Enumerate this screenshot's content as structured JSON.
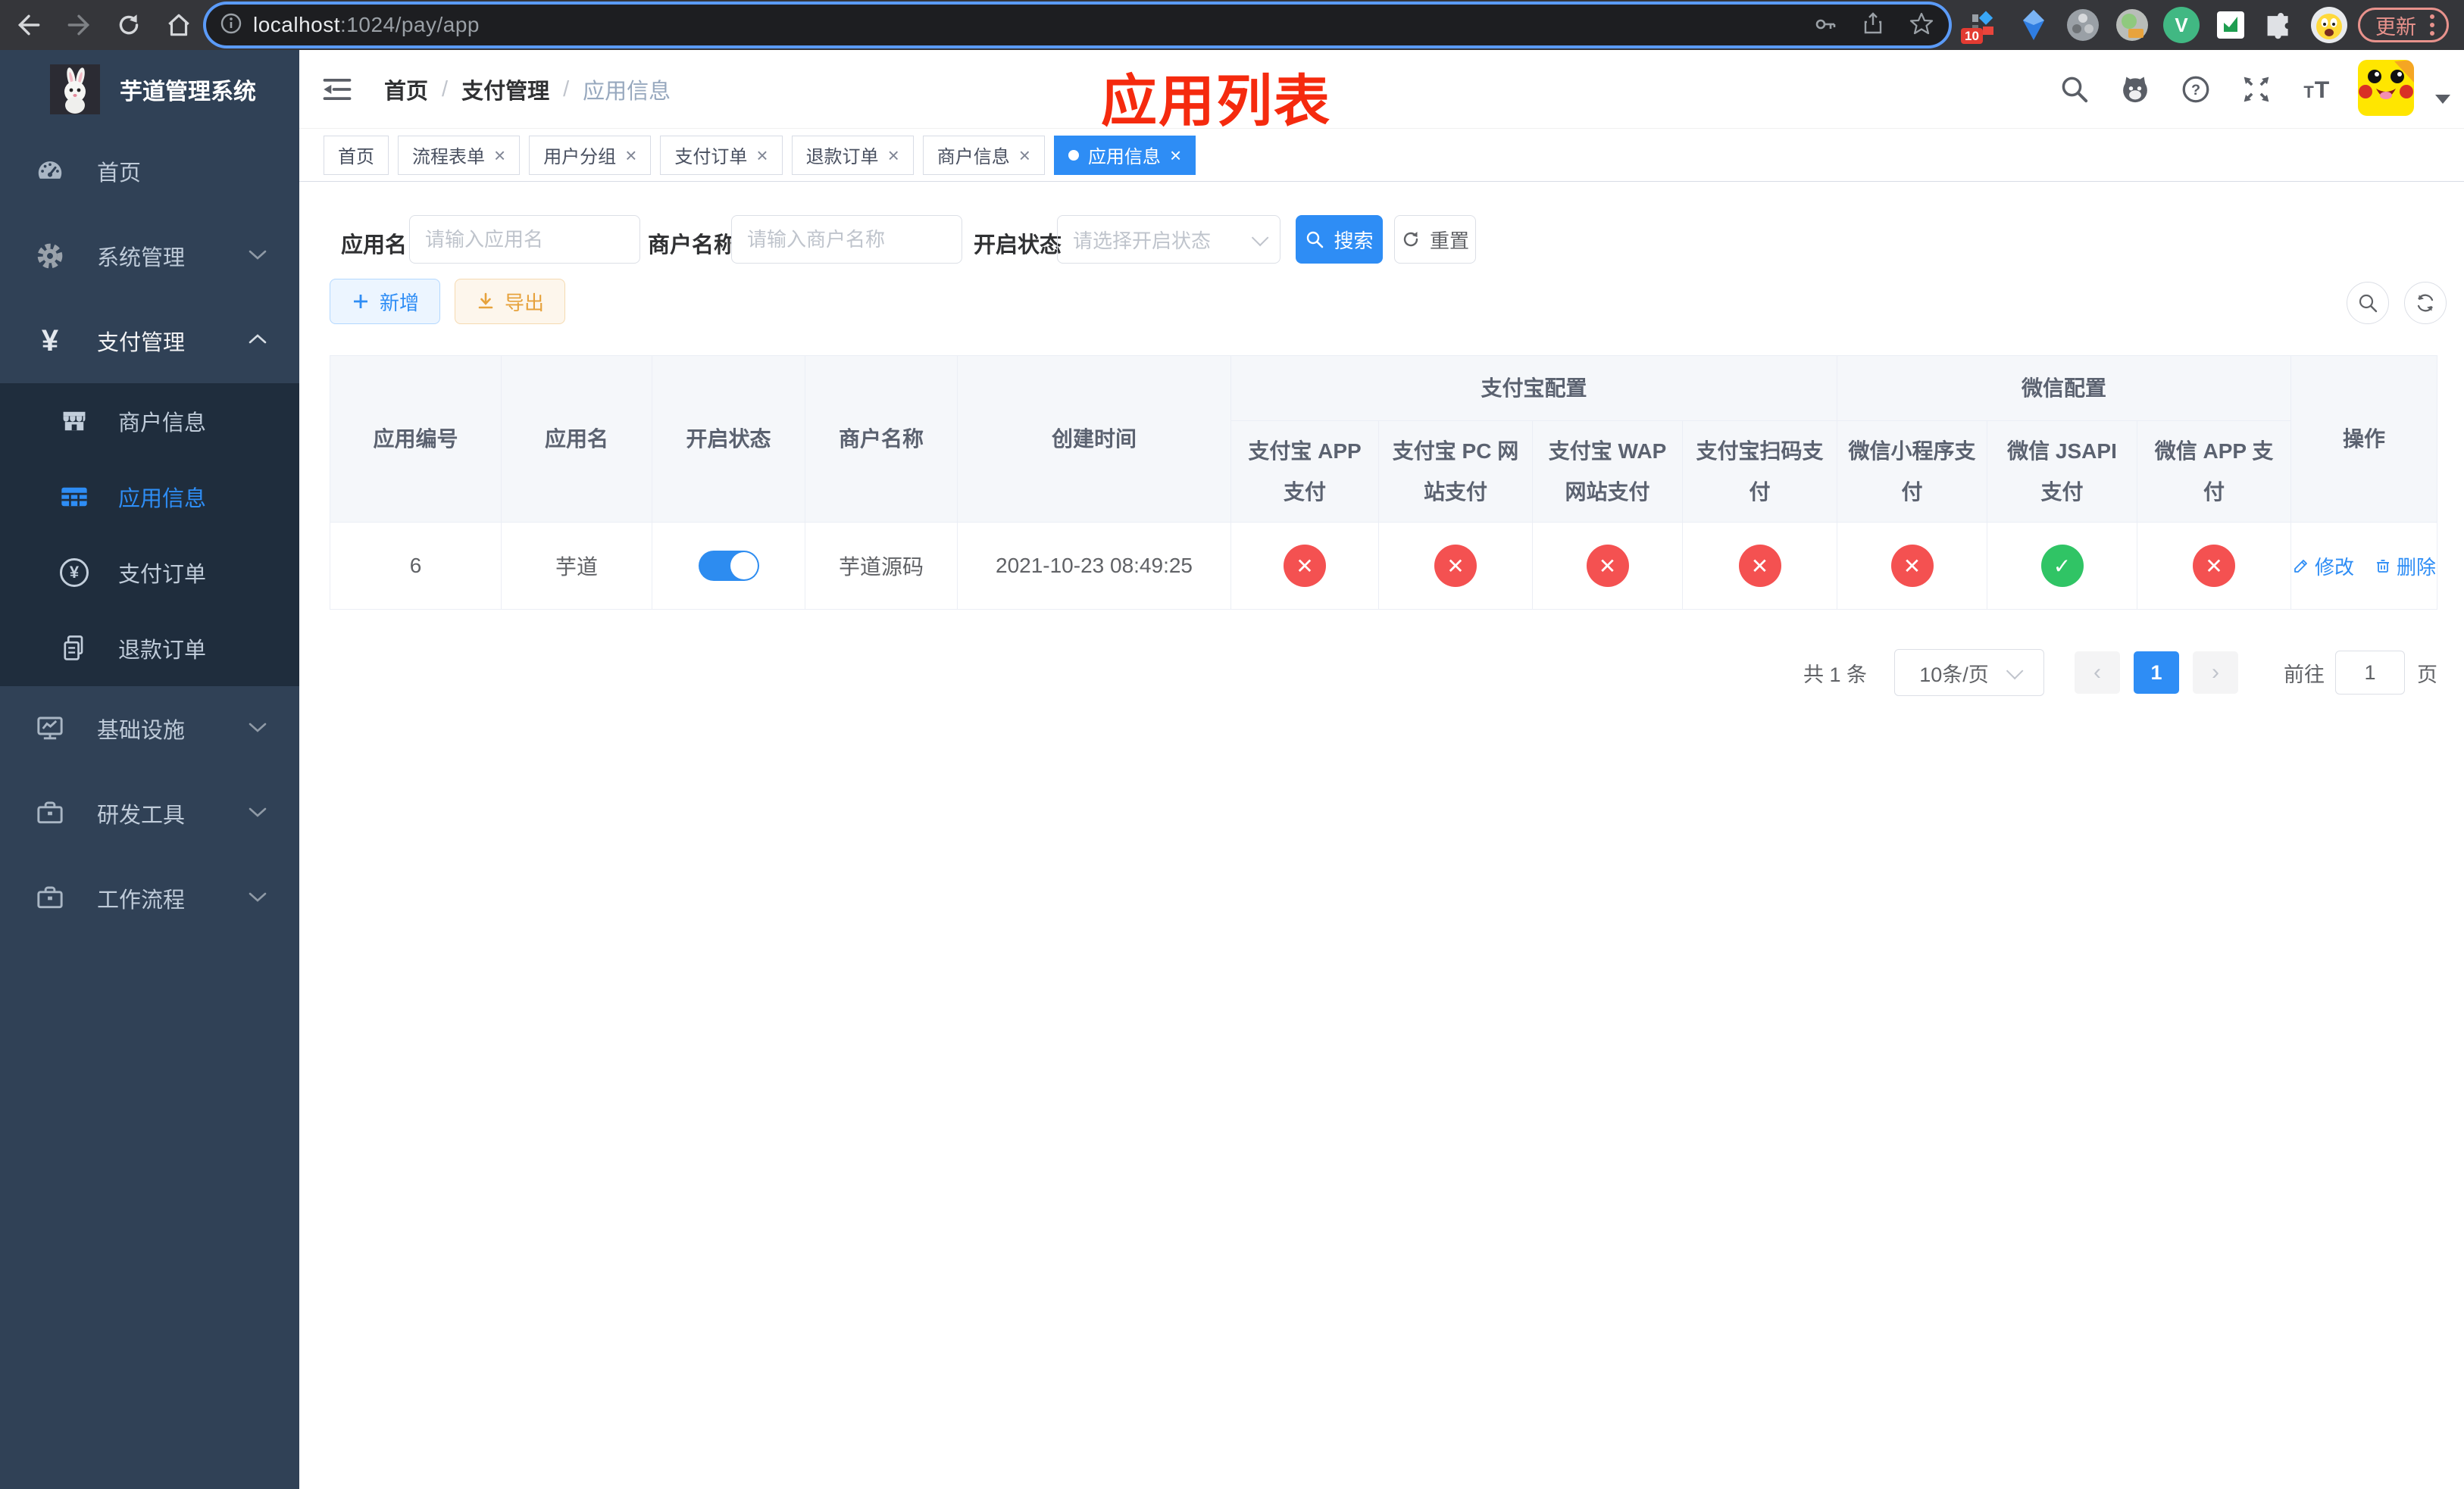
{
  "browser": {
    "url_host": "localhost",
    "url_path": ":1024/pay/app",
    "update_label": "更新",
    "ext_badge": "10"
  },
  "sidebar": {
    "title": "芋道管理系统",
    "menu": [
      {
        "label": "首页"
      },
      {
        "label": "系统管理"
      },
      {
        "label": "支付管理"
      },
      {
        "label": "商户信息"
      },
      {
        "label": "应用信息"
      },
      {
        "label": "支付订单"
      },
      {
        "label": "退款订单"
      },
      {
        "label": "基础设施"
      },
      {
        "label": "研发工具"
      },
      {
        "label": "工作流程"
      }
    ]
  },
  "header": {
    "breadcrumb": {
      "home": "首页",
      "section": "支付管理",
      "current": "应用信息"
    },
    "overlay_title": "应用列表"
  },
  "tags": {
    "close_glyph": "×",
    "items": [
      {
        "label": "首页",
        "closable": false,
        "active": false
      },
      {
        "label": "流程表单",
        "closable": true,
        "active": false
      },
      {
        "label": "用户分组",
        "closable": true,
        "active": false
      },
      {
        "label": "支付订单",
        "closable": true,
        "active": false
      },
      {
        "label": "退款订单",
        "closable": true,
        "active": false
      },
      {
        "label": "商户信息",
        "closable": true,
        "active": false
      },
      {
        "label": "应用信息",
        "closable": true,
        "active": true
      }
    ]
  },
  "filters": {
    "app_name_label": "应用名",
    "app_name_placeholder": "请输入应用名",
    "merchant_label": "商户名称",
    "merchant_placeholder": "请输入商户名称",
    "status_label": "开启状态",
    "status_placeholder": "请选择开启状态",
    "search_label": "搜索",
    "reset_label": "重置"
  },
  "toolbar": {
    "add_label": "新增",
    "export_label": "导出"
  },
  "table": {
    "columns": [
      "应用编号",
      "应用名",
      "开启状态",
      "商户名称",
      "创建时间"
    ],
    "groups": {
      "alipay": "支付宝配置",
      "wechat": "微信配置",
      "action": "操作"
    },
    "alipay_columns": [
      "支付宝 APP 支付",
      "支付宝 PC 网站支付",
      "支付宝 WAP 网站支付",
      "支付宝扫码支付"
    ],
    "wechat_columns": [
      "微信小程序支付",
      "微信 JSAPI 支付",
      "微信 APP 支付"
    ],
    "row": {
      "id": "6",
      "name": "芋道",
      "enabled": true,
      "merchant": "芋道源码",
      "created": "2021-10-23 08:49:25",
      "config_status": [
        false,
        false,
        false,
        false,
        false,
        true,
        false
      ],
      "edit_label": "修改",
      "delete_label": "删除"
    }
  },
  "pagination": {
    "total": "共 1 条",
    "page_size": "10条/页",
    "prev_glyph": "‹",
    "next_glyph": "›",
    "current_page": "1",
    "goto_label": "前往",
    "goto_value": "1",
    "page_unit": "页"
  },
  "icons": {
    "check_glyph": "✓",
    "cross_glyph": "✕"
  },
  "colors": {
    "primary": "#2e8df5",
    "danger": "#f45151",
    "success": "#30c465",
    "warning": "#e6a23c",
    "annotation_red": "#f52a0e",
    "sidebar_bg": "#304156",
    "submenu_bg": "#1f2d3d"
  }
}
